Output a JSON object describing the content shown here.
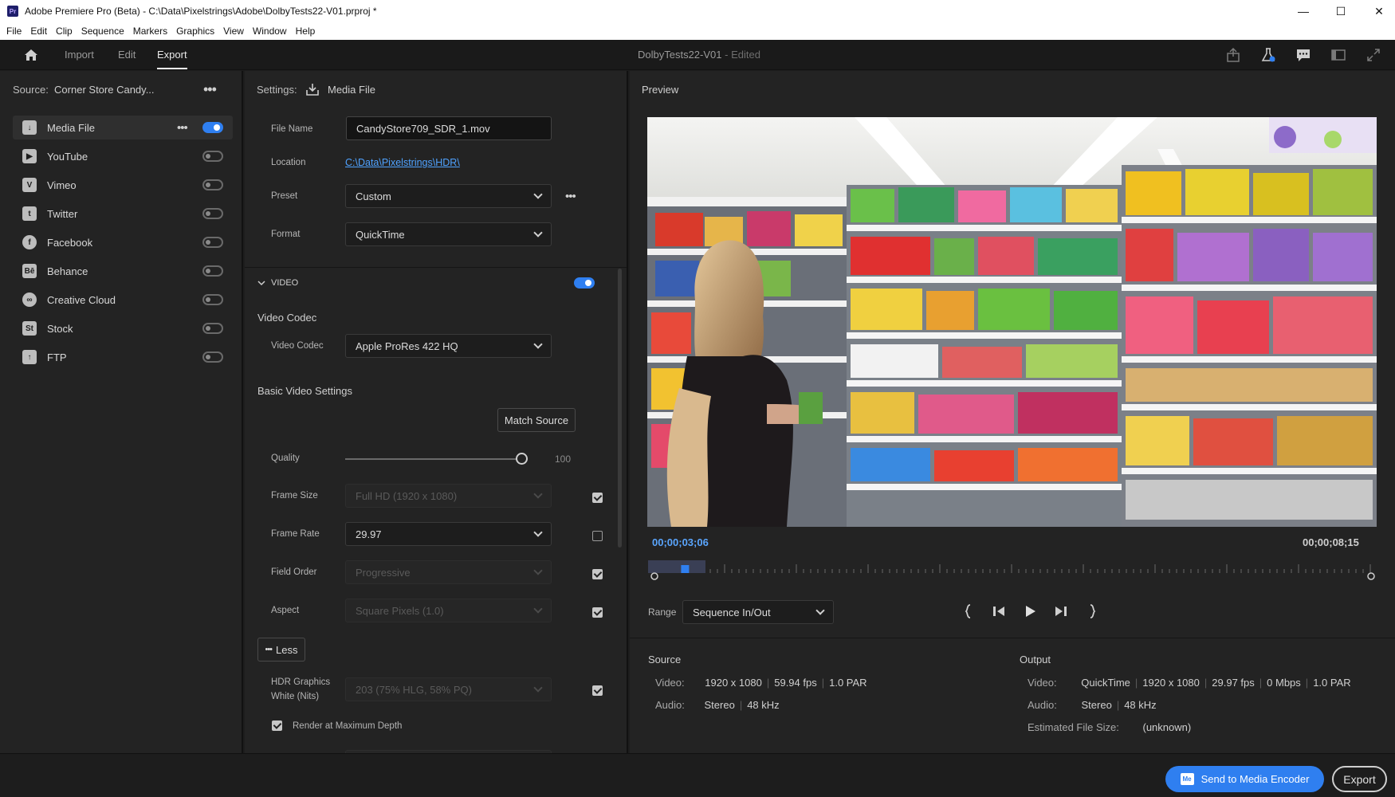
{
  "window": {
    "title": "Adobe Premiere Pro (Beta) - C:\\Data\\Pixelstrings\\Adobe\\DolbyTests22-V01.prproj *",
    "icon_text": "Pr",
    "minimize": "—",
    "maximize": "☐",
    "close": "✕"
  },
  "menu": [
    "File",
    "Edit",
    "Clip",
    "Sequence",
    "Markers",
    "Graphics",
    "View",
    "Window",
    "Help"
  ],
  "appbar": {
    "tabs": [
      "Import",
      "Edit",
      "Export"
    ],
    "active_tab": "Export",
    "project": "DolbyTests22-V01",
    "project_state": "- Edited"
  },
  "source": {
    "label": "Source:",
    "value": "Corner Store Candy..."
  },
  "destinations": [
    {
      "name": "Media File",
      "icon": "download-icon",
      "glyph": "↓",
      "on": true
    },
    {
      "name": "YouTube",
      "icon": "youtube-icon",
      "glyph": "▶",
      "on": false
    },
    {
      "name": "Vimeo",
      "icon": "vimeo-icon",
      "glyph": "V",
      "on": false
    },
    {
      "name": "Twitter",
      "icon": "twitter-icon",
      "glyph": "t",
      "on": false
    },
    {
      "name": "Facebook",
      "icon": "facebook-icon",
      "glyph": "f",
      "on": false
    },
    {
      "name": "Behance",
      "icon": "behance-icon",
      "glyph": "Bē",
      "on": false
    },
    {
      "name": "Creative Cloud",
      "icon": "creative-cloud-icon",
      "glyph": "∞",
      "on": false
    },
    {
      "name": "Stock",
      "icon": "stock-icon",
      "glyph": "St",
      "on": false
    },
    {
      "name": "FTP",
      "icon": "ftp-upload-icon",
      "glyph": "↑",
      "on": false
    }
  ],
  "settings": {
    "label": "Settings:",
    "target": "Media File",
    "file_name_label": "File Name",
    "file_name": "CandyStore709_SDR_1.mov",
    "location_label": "Location",
    "location": "C:\\Data\\Pixelstrings\\HDR\\",
    "preset_label": "Preset",
    "preset": "Custom",
    "format_label": "Format",
    "format": "QuickTime",
    "video_section": "VIDEO",
    "video_codec_header": "Video Codec",
    "video_codec_label": "Video Codec",
    "video_codec": "Apple ProRes 422 HQ",
    "basic_header": "Basic Video Settings",
    "match_source": "Match Source",
    "quality_label": "Quality",
    "quality": 100,
    "quality_text": "100",
    "frame_size_label": "Frame Size",
    "frame_size": "Full HD (1920 x 1080)",
    "frame_rate_label": "Frame Rate",
    "frame_rate": "29.97",
    "field_order_label": "Field Order",
    "field_order": "Progressive",
    "aspect_label": "Aspect",
    "aspect": "Square Pixels (1.0)",
    "less_button": "Less",
    "hdr_label_1": "HDR Graphics",
    "hdr_label_2": "White (Nits)",
    "hdr_value": "203 (75% HLG, 58% PQ)",
    "render_max_depth": "Render at Maximum Depth"
  },
  "preview": {
    "title": "Preview",
    "timecode_current": "00;00;03;06",
    "timecode_end": "00;00;08;15",
    "playhead_fraction": 0.03,
    "range_label": "Range",
    "range_value": "Sequence In/Out"
  },
  "source_info": {
    "title": "Source",
    "video_label": "Video:",
    "video": [
      "1920 x 1080",
      "59.94 fps",
      "1.0 PAR"
    ],
    "audio_label": "Audio:",
    "audio": [
      "Stereo",
      "48 kHz"
    ]
  },
  "output_info": {
    "title": "Output",
    "video_label": "Video:",
    "video": [
      "QuickTime",
      "1920 x 1080",
      "29.97 fps",
      "0 Mbps",
      "1.0 PAR"
    ],
    "audio_label": "Audio:",
    "audio": [
      "Stereo",
      "48 kHz"
    ],
    "size_label": "Estimated File Size:",
    "size_value": "(unknown)"
  },
  "footer": {
    "send_button": "Send to Media Encoder",
    "send_icon_text": "Me",
    "export_button": "Export"
  },
  "colors": {
    "accent": "#2f7ff0",
    "timecode": "#5aa6ff",
    "panel": "#232323"
  }
}
